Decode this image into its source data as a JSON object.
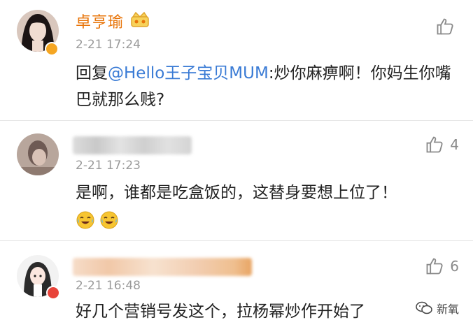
{
  "comments": [
    {
      "username": "卓亨瑜",
      "time": "2-21 17:24",
      "text_prefix": "回复",
      "mention": "@Hello王子宝贝MUM",
      "text_suffix": ":炒你麻痹啊！你妈生你嘴巴就那么贱?",
      "likes": ""
    },
    {
      "username": "",
      "time": "2-21 17:23",
      "text": "是啊，谁都是吃盒饭的，这替身要想上位了！",
      "likes": "4",
      "emojis": [
        "laughing-crying-emoji",
        "laughing-crying-emoji"
      ]
    },
    {
      "username": "",
      "time": "2-21 16:48",
      "text": "好几个营销号发这个，拉杨幂炒作开始了",
      "likes": "6"
    }
  ],
  "watermark": {
    "label": "新氧"
  },
  "colors": {
    "username": "#e8750a",
    "mention": "#3a7bd5",
    "time": "#9a9a9a",
    "like_icon": "#8a8a8a"
  },
  "icons": {
    "like": "thumbs-up-icon",
    "vip": "crown-icon",
    "watermark": "wechat-logo-icon"
  }
}
